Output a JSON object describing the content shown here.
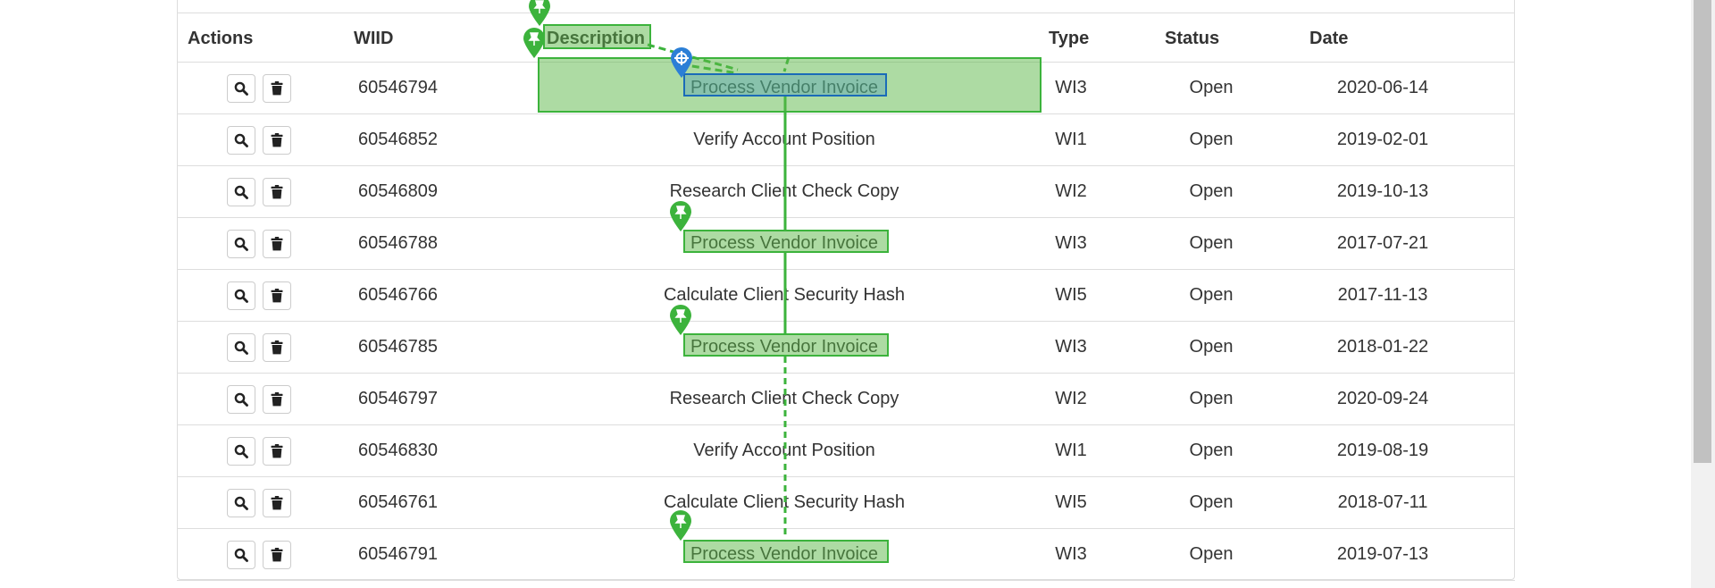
{
  "columns": {
    "actions": "Actions",
    "wiid": "WIID",
    "description": "Description",
    "type": "Type",
    "status": "Status",
    "date": "Date"
  },
  "rows": [
    {
      "wiid": "60546794",
      "description": "Process Vendor Invoice",
      "type": "WI3",
      "status": "Open",
      "date": "2020-06-14"
    },
    {
      "wiid": "60546852",
      "description": "Verify Account Position",
      "type": "WI1",
      "status": "Open",
      "date": "2019-02-01"
    },
    {
      "wiid": "60546809",
      "description": "Research Client Check Copy",
      "type": "WI2",
      "status": "Open",
      "date": "2019-10-13"
    },
    {
      "wiid": "60546788",
      "description": "Process Vendor Invoice",
      "type": "WI3",
      "status": "Open",
      "date": "2017-07-21"
    },
    {
      "wiid": "60546766",
      "description": "Calculate Client Security Hash",
      "type": "WI5",
      "status": "Open",
      "date": "2017-11-13"
    },
    {
      "wiid": "60546785",
      "description": "Process Vendor Invoice",
      "type": "WI3",
      "status": "Open",
      "date": "2018-01-22"
    },
    {
      "wiid": "60546797",
      "description": "Research Client Check Copy",
      "type": "WI2",
      "status": "Open",
      "date": "2020-09-24"
    },
    {
      "wiid": "60546830",
      "description": "Verify Account Position",
      "type": "WI1",
      "status": "Open",
      "date": "2019-08-19"
    },
    {
      "wiid": "60546761",
      "description": "Calculate Client Security Hash",
      "type": "WI5",
      "status": "Open",
      "date": "2018-07-11"
    },
    {
      "wiid": "60546791",
      "description": "Process Vendor Invoice",
      "type": "WI3",
      "status": "Open",
      "date": "2019-07-13"
    }
  ],
  "icons": {
    "view": "search-icon",
    "delete": "trash-icon",
    "pin": "pushpin-icon",
    "target": "crosshair-icon"
  },
  "colors": {
    "highlight_green": "#5cb848",
    "highlight_border": "#3cb33c",
    "selected_blue": "#1a6bb8",
    "pin_green": "#3cb33c",
    "pin_blue": "#2b7fd6"
  }
}
